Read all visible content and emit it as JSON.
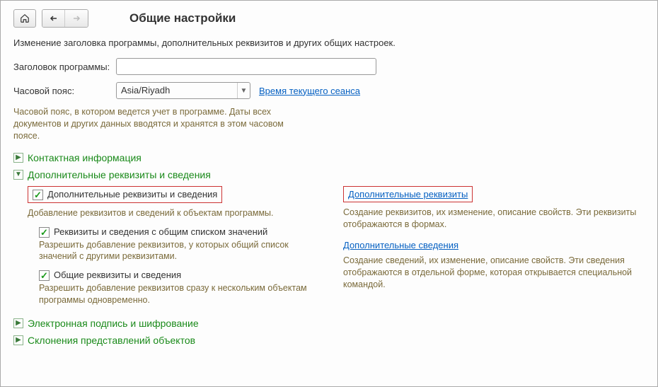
{
  "header": {
    "title": "Общие настройки"
  },
  "description": "Изменение заголовка программы, дополнительных реквизитов и других общих настроек.",
  "form": {
    "app_title_label": "Заголовок программы:",
    "app_title_value": "",
    "timezone_label": "Часовой пояс:",
    "timezone_value": "Asia/Riyadh",
    "session_link": "Время текущего сеанса",
    "timezone_hint": "Часовой пояс, в котором ведется учет в программе. Даты всех документов и других данных вводятся и хранятся в этом часовом поясе."
  },
  "sections": {
    "contact": {
      "title": "Контактная информация",
      "expanded": false
    },
    "extra": {
      "title": "Дополнительные реквизиты и сведения",
      "expanded": true,
      "cb_main": "Дополнительные реквизиты и сведения",
      "cb_main_hint": "Добавление реквизитов и сведений к объектам программы.",
      "cb_shared": "Реквизиты и сведения с общим списком значений",
      "cb_shared_hint": "Разрешить добавление реквизитов, у которых общий список значений с другими реквизитами.",
      "cb_common": "Общие реквизиты и сведения",
      "cb_common_hint": "Разрешить добавление реквизитов сразу к нескольким объектам программы одновременно.",
      "link_props": "Дополнительные реквизиты",
      "link_props_hint": "Создание реквизитов, их изменение, описание свойств. Эти реквизиты отображаются в формах.",
      "link_info": "Дополнительные сведения",
      "link_info_hint": "Создание сведений, их изменение, описание свойств. Эти сведения отображаются в отдельной форме, которая открывается специальной командой."
    },
    "esign": {
      "title": "Электронная подпись и шифрование",
      "expanded": false
    },
    "declension": {
      "title": "Склонения представлений объектов",
      "expanded": false
    }
  }
}
